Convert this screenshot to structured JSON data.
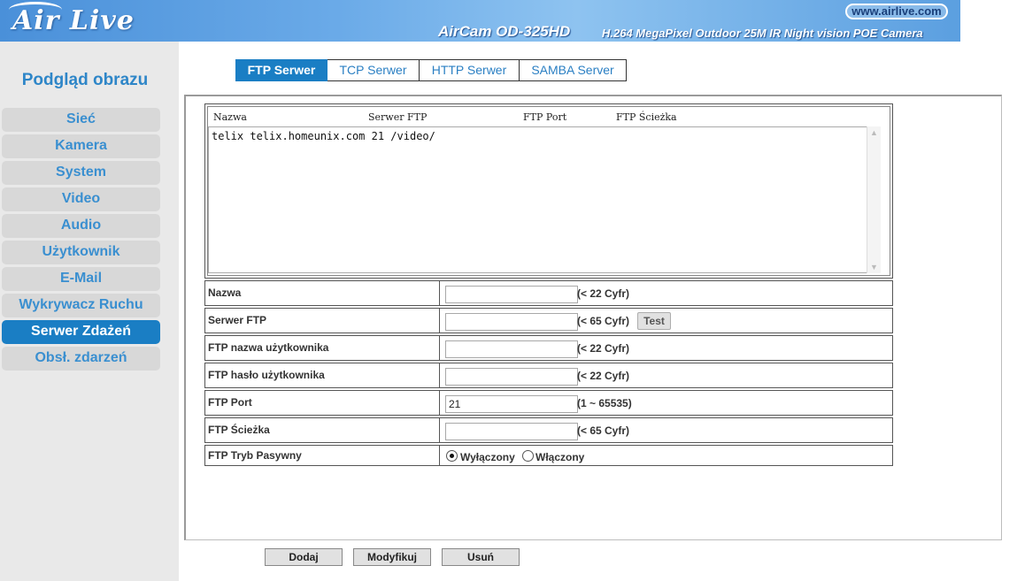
{
  "header": {
    "logo": "Air Live",
    "url": "www.airlive.com",
    "product": "AirCam OD-325HD",
    "description": "H.264 MegaPixel Outdoor 25M IR Night vision POE Camera"
  },
  "sidebar": {
    "title": "Podgląd obrazu",
    "items": [
      {
        "label": "Sieć"
      },
      {
        "label": "Kamera"
      },
      {
        "label": "System"
      },
      {
        "label": "Video"
      },
      {
        "label": "Audio"
      },
      {
        "label": "Użytkownik"
      },
      {
        "label": "E-Mail"
      },
      {
        "label": "Wykrywacz Ruchu"
      },
      {
        "label": "Serwer Zdażeń"
      },
      {
        "label": "Obsł. zdarzeń"
      }
    ],
    "active_index": 8
  },
  "tabs": [
    {
      "label": "FTP Serwer"
    },
    {
      "label": "TCP Serwer"
    },
    {
      "label": "HTTP Serwer"
    },
    {
      "label": "SAMBA Server"
    }
  ],
  "list": {
    "columns": [
      "Nazwa",
      "Serwer FTP",
      "FTP Port",
      "FTP Ścieżka"
    ],
    "rows": [
      "telix telix.homeunix.com 21 /video/"
    ]
  },
  "form": {
    "name": {
      "label": "Nazwa",
      "value": "",
      "hint": "(< 22 Cyfr)"
    },
    "server": {
      "label": "Serwer FTP",
      "value": "",
      "hint": "(< 65 Cyfr)",
      "test": "Test"
    },
    "user": {
      "label": "FTP nazwa użytkownika",
      "value": "",
      "hint": "(< 22 Cyfr)"
    },
    "password": {
      "label": "FTP hasło użytkownika",
      "value": "",
      "hint": "(< 22 Cyfr)"
    },
    "port": {
      "label": "FTP Port",
      "value": "21",
      "hint": "(1 ~ 65535)"
    },
    "path": {
      "label": "FTP Ścieżka",
      "value": "",
      "hint": "(< 65 Cyfr)"
    },
    "passive": {
      "label": "FTP Tryb Pasywny",
      "off": "Wyłączony",
      "on": "Włączony",
      "selected": "off"
    }
  },
  "buttons": {
    "add": "Dodaj",
    "modify": "Modyfikuj",
    "delete": "Usuń"
  }
}
